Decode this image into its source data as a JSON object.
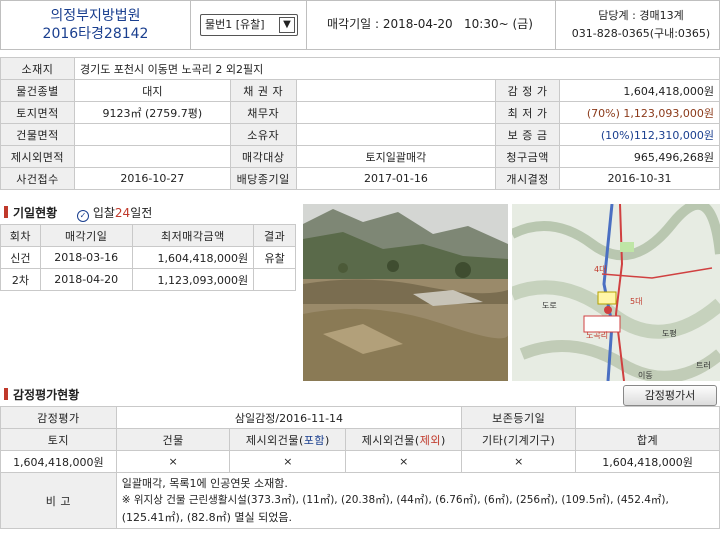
{
  "header": {
    "court": "의정부지방법원",
    "case_no": "2016타경28142",
    "item_select": "물번1 [유찰]",
    "sale_date_label": "매각기일",
    "sale_date_value": ": 2018-04-20   10:30~ (금)",
    "dept": "담당계 : 경매13계",
    "phone": "031-828-0365(구내:0365)"
  },
  "info": {
    "addr_label": "소재지",
    "addr_value": "경기도 포천시 이동면 노곡리 2 외2필지",
    "type_label": "물건종별",
    "type_value": "대지",
    "creditor_label": "채 권 자",
    "appraisal_label": "감 정 가",
    "appraisal_value": "1,604,418,000원",
    "land_label": "토지면적",
    "land_value": "9123㎡ (2759.7평)",
    "debtor_label": "채무자",
    "min_label": "최 저 가",
    "min_value": "(70%) 1,123,093,000원",
    "bld_label": "건물면적",
    "owner_label": "소유자",
    "deposit_label": "보 증 금",
    "deposit_value": "(10%)112,310,000원",
    "excl_label": "제시외면적",
    "target_label": "매각대상",
    "target_value": "토지일괄매각",
    "claim_label": "청구금액",
    "claim_value": "965,496,268원",
    "accept_label": "사건접수",
    "accept_value": "2016-10-27",
    "divdl_label": "배당종기일",
    "divdl_value": "2017-01-16",
    "start_label": "개시결정",
    "start_value": "2016-10-31"
  },
  "history": {
    "title": "기일현황",
    "bid_prefix": "입찰",
    "bid_days": "24",
    "bid_suffix": "일전",
    "columns": [
      "회차",
      "매각기일",
      "최저매각금액",
      "결과"
    ],
    "rows": [
      {
        "round": "신건",
        "date": "2018-03-16",
        "price": "1,604,418,000원",
        "result": "유찰"
      },
      {
        "round": "2차",
        "date": "2018-04-20",
        "price": "1,123,093,000원",
        "result": ""
      }
    ]
  },
  "map": {
    "labels": [
      "4대",
      "5대",
      "도로",
      "이동",
      "노곡리",
      "도평",
      "트러"
    ]
  },
  "appraisal": {
    "title": "감정평가현황",
    "report_button": "감정평가서",
    "org_label": "감정평가",
    "org_value": "삼일감정/2016-11-14",
    "retention_label": "보존등기일",
    "cols": {
      "land": "토지",
      "bld": "건물",
      "excl_a_prefix": "제시외건물(",
      "excl_a_em": "포함",
      "excl_b_prefix": "제시외건물(",
      "excl_b_em": "제외",
      "close": ")",
      "other": "기타(기계기구)",
      "total": "합계"
    },
    "vals": {
      "land": "1,604,418,000원",
      "bld": "×",
      "excl_a": "×",
      "excl_b": "×",
      "other": "×",
      "total": "1,604,418,000원"
    },
    "remark_label": "비 고",
    "remark_lines": [
      "일괄매각, 목록1에 인공연못 소재함.",
      "※ 위지상 건물 근린생활시설(373.3㎡), (11㎡), (20.38㎡), (44㎡), (6.76㎡), (6㎡), (256㎡), (109.5㎡), (452.4㎡),",
      "(125.41㎡), (82.8㎡) 멸실 되었음."
    ]
  },
  "colors": {
    "accent_blue": "#1a3f8f",
    "accent_red": "#c0392b",
    "label_bg": "#efefef"
  }
}
